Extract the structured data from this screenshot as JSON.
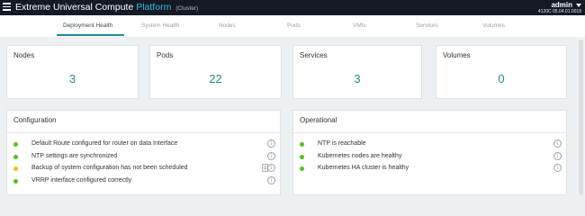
{
  "header": {
    "title_main": "Extreme Universal Compute",
    "title_accent": "Platform",
    "title_sub": "(Cluster)",
    "user": "admin",
    "version": "4120C 05.04.01.0018",
    "menu_icon": "hamburger-menu-icon",
    "user_caret_icon": "caret-down-icon"
  },
  "tabs": [
    {
      "label": "Deployment Health",
      "active": true
    },
    {
      "label": "System Health"
    },
    {
      "label": "Nodes"
    },
    {
      "label": "Pods"
    },
    {
      "label": "VMIs"
    },
    {
      "label": "Services"
    },
    {
      "label": "Volumes"
    }
  ],
  "stats": [
    {
      "label": "Nodes",
      "value": "3"
    },
    {
      "label": "Pods",
      "value": "22"
    },
    {
      "label": "Services",
      "value": "3"
    },
    {
      "label": "Volumes",
      "value": "0"
    }
  ],
  "configuration": {
    "title": "Configuration",
    "items": [
      {
        "text": "Default Route configured for router on data Interface",
        "status": "ok"
      },
      {
        "text": "NTP settings are synchronized",
        "status": "ok"
      },
      {
        "text": "Backup of system configuration has not been scheduled",
        "status": "warning"
      },
      {
        "text": "VRRP interface configured correctly",
        "status": "ok"
      }
    ]
  },
  "operational": {
    "title": "Operational",
    "items": [
      {
        "text": "NTP is reachable",
        "status": "ok"
      },
      {
        "text": "Kubernetes nodes are healthy",
        "status": "ok"
      },
      {
        "text": "Kubernetes HA cluster is healthy",
        "status": "ok"
      }
    ]
  },
  "icons": {
    "info": "i"
  },
  "colors": {
    "topbar": "#131a24",
    "accent": "#3cb6e8",
    "stat_value": "#1b8e9b",
    "tab_underline": "#1a8ea0",
    "status_ok": "#52c41a",
    "status_warning": "#f2c200"
  }
}
